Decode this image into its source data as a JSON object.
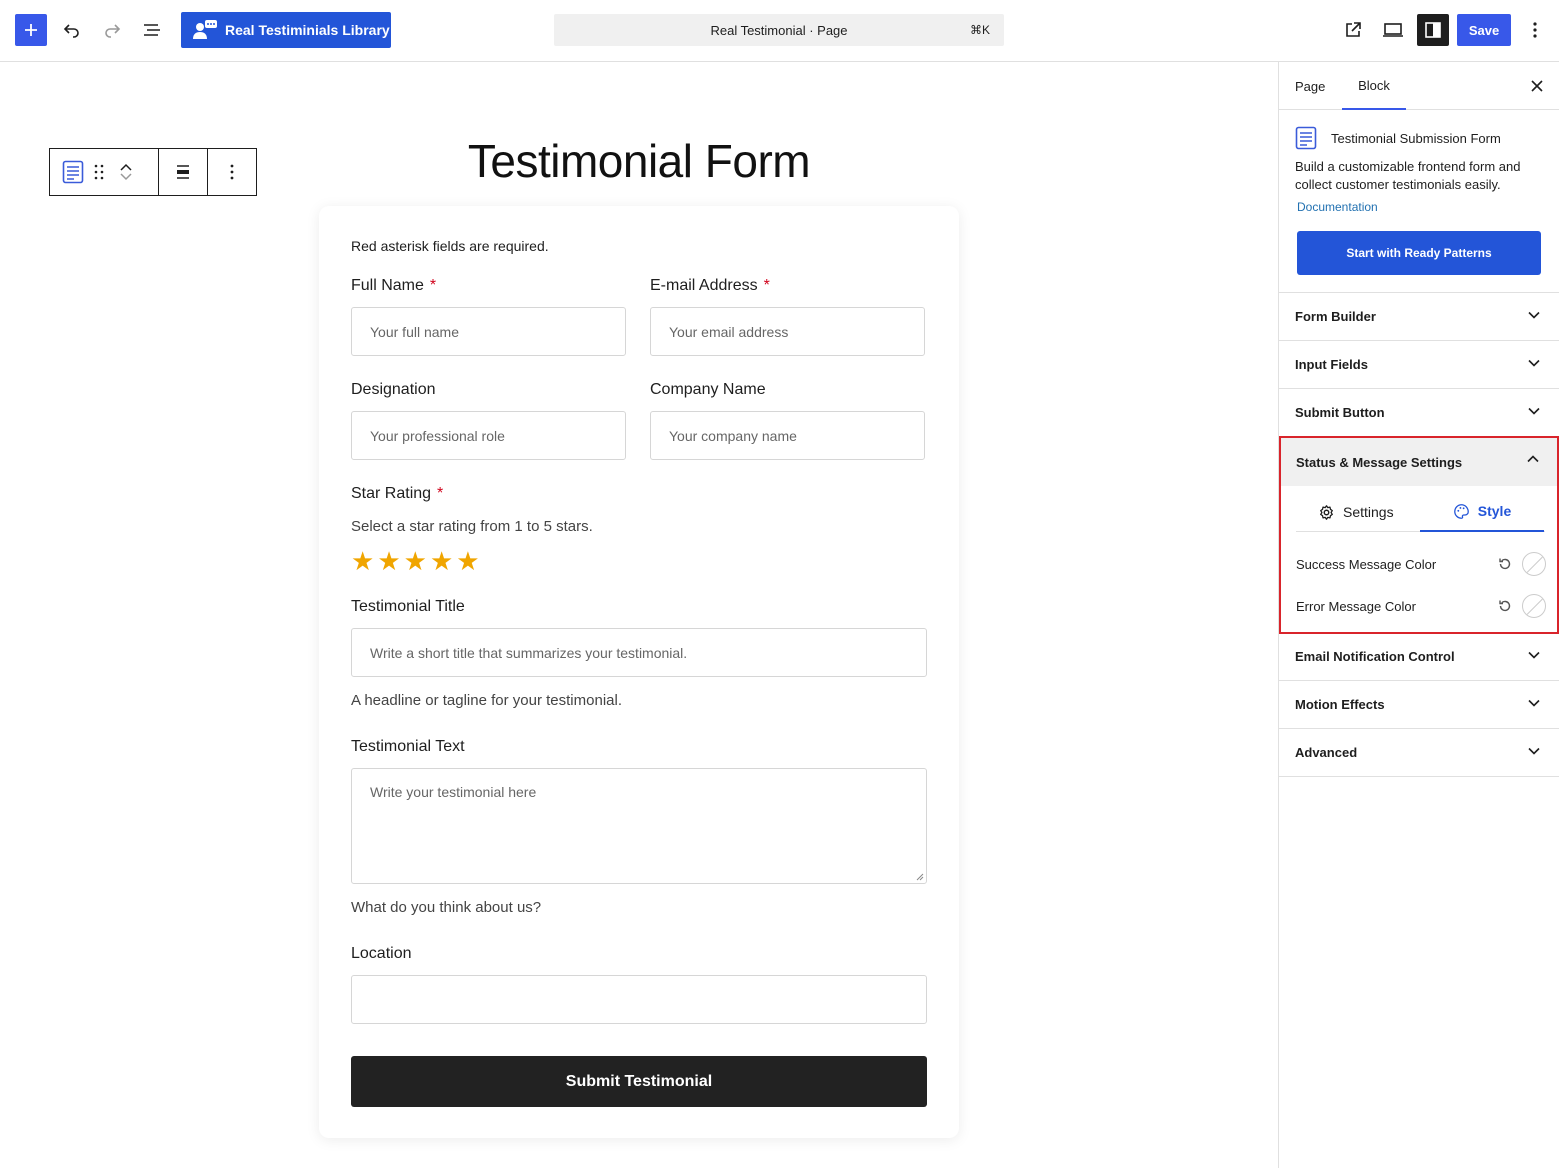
{
  "topbar": {
    "library_label": "Real Testiminials Library",
    "command_title": "Real Testimonial · Page",
    "command_shortcut": "⌘K",
    "save_label": "Save"
  },
  "canvas": {
    "page_title": "Testimonial Form",
    "form": {
      "note": "Red asterisk fields are required.",
      "required_mark": "*",
      "full_name": {
        "label": "Full Name",
        "placeholder": "Your full name"
      },
      "email": {
        "label": "E-mail Address",
        "placeholder": "Your email address"
      },
      "designation": {
        "label": "Designation",
        "placeholder": "Your professional role"
      },
      "company": {
        "label": "Company Name",
        "placeholder": "Your company name"
      },
      "rating": {
        "label": "Star Rating",
        "help": "Select a star rating from 1 to 5 stars.",
        "stars": 5,
        "star_glyph": "★"
      },
      "title": {
        "label": "Testimonial Title",
        "placeholder": "Write a short title that summarizes your testimonial.",
        "help": "A headline or tagline for your testimonial."
      },
      "text": {
        "label": "Testimonial Text",
        "placeholder": "Write your testimonial here",
        "help": "What do you think about us?"
      },
      "location": {
        "label": "Location",
        "placeholder": ""
      },
      "submit_label": "Submit Testimonial"
    }
  },
  "sidebar": {
    "tabs": {
      "page": "Page",
      "block": "Block"
    },
    "block": {
      "title": "Testimonial Submission Form",
      "description": "Build a customizable frontend form and collect customer testimonials easily.",
      "doc_link": "Documentation",
      "patterns_button": "Start with Ready Patterns"
    },
    "panels": {
      "form_builder": "Form Builder",
      "input_fields": "Input Fields",
      "submit_button": "Submit Button",
      "status": "Status & Message Settings",
      "email": "Email Notification Control",
      "motion": "Motion Effects",
      "advanced": "Advanced"
    },
    "status_tabs": {
      "settings": "Settings",
      "style": "Style"
    },
    "colors": {
      "success": "Success Message Color",
      "error": "Error Message Color"
    }
  },
  "theme": {
    "accent": "#3858e9",
    "brand_button": "#2355d8",
    "highlight_border": "#d9242b",
    "star": "#f0a500"
  }
}
